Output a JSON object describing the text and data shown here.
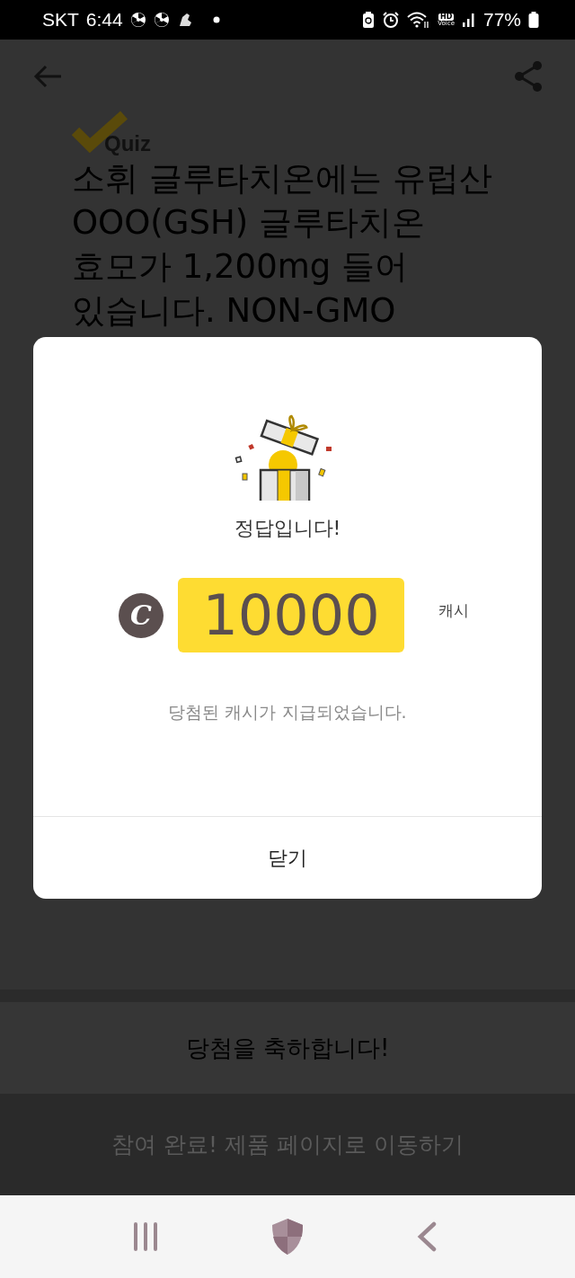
{
  "status_bar": {
    "carrier": "SKT",
    "time": "6:44",
    "hd_label": "HD",
    "voice_label": "Voice",
    "battery": "77%"
  },
  "header": {
    "logo_text": "Quiz"
  },
  "question_lines": [
    "소휘 글루타치온에는 유럽산",
    "OOO(GSH) 글루타치온",
    "효모가 1,200mg 들어",
    "있습니다. NON-GMO"
  ],
  "dialog": {
    "title": "정답입니다!",
    "coin_symbol": "C",
    "amount": "10000",
    "unit": "캐시",
    "message": "당첨된 캐시가 지급되었습니다.",
    "close_button": "닫기"
  },
  "congrats": "당첨을 축하합니다!",
  "action_button": {
    "label": "참여 완료! 제품 페이지로 이동하기",
    "disabled": true
  }
}
